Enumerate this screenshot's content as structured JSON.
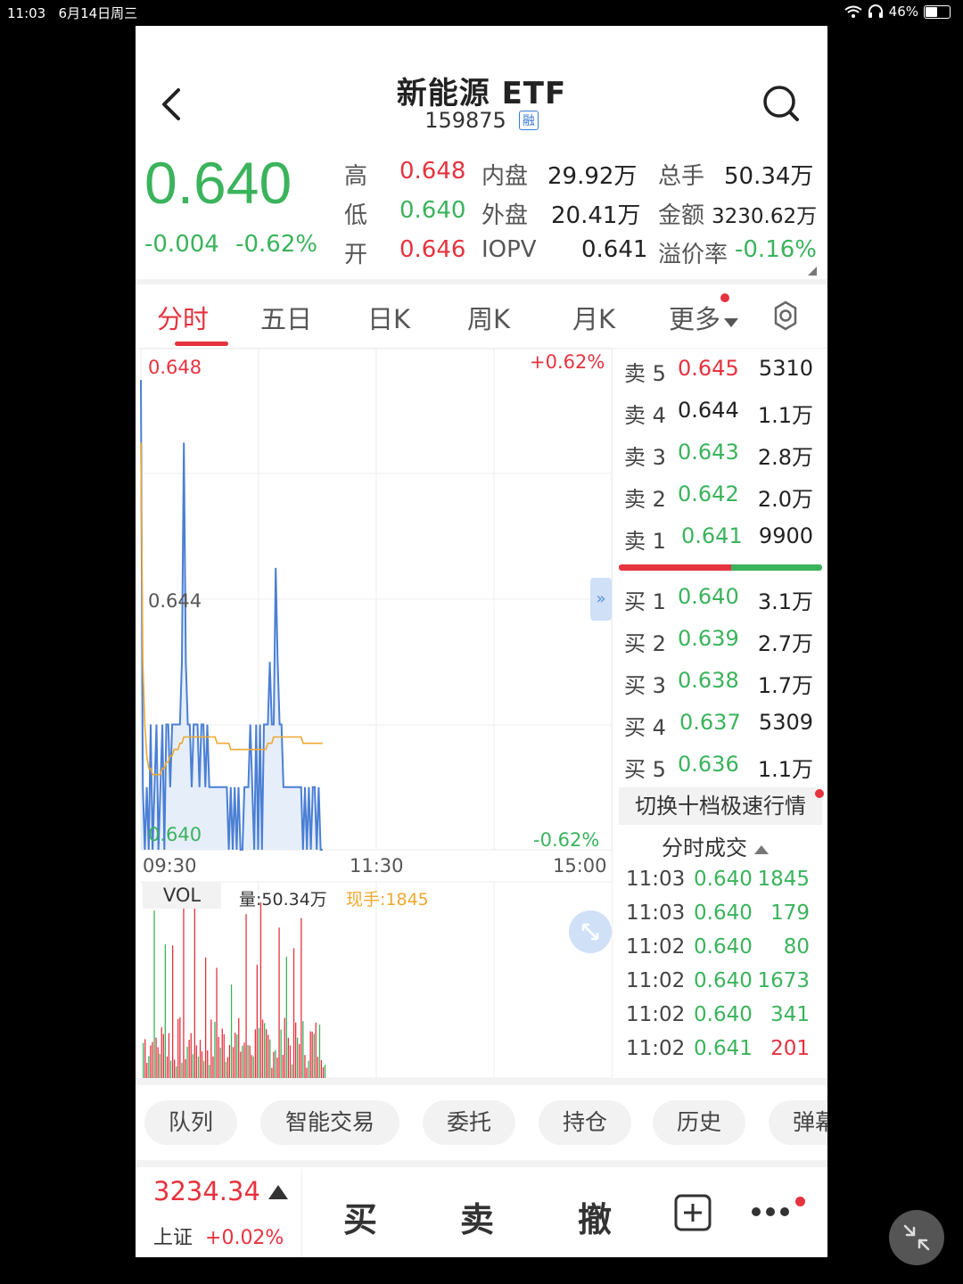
{
  "status_bar": {
    "time": "11:03",
    "date": "6月14日周三",
    "battery": "46%"
  },
  "header": {
    "title": "新能源 ETF",
    "code": "159875",
    "badge": "融"
  },
  "quote": {
    "price": "0.640",
    "change": "-0.004",
    "change_pct": "-0.62%",
    "stats": {
      "high_label": "高",
      "high": "0.648",
      "low_label": "低",
      "low": "0.640",
      "open_label": "开",
      "open": "0.646",
      "inner_label": "内盘",
      "inner": "29.92万",
      "outer_label": "外盘",
      "outer": "20.41万",
      "iopv_label": "IOPV",
      "iopv": "0.641",
      "total_label": "总手",
      "total": "50.34万",
      "amount_label": "金额",
      "amount": "3230.62万",
      "premium_label": "溢价率",
      "premium": "-0.16%"
    }
  },
  "tabs": [
    {
      "label": "分时",
      "active": true
    },
    {
      "label": "五日"
    },
    {
      "label": "日K"
    },
    {
      "label": "周K"
    },
    {
      "label": "月K"
    },
    {
      "label": "更多"
    }
  ],
  "chart": {
    "y_top": "0.648",
    "y_mid": "0.644",
    "y_bottom": "0.640",
    "pct_top": "+0.62%",
    "pct_bottom": "-0.62%",
    "x_start": "09:30",
    "x_mid": "11:30",
    "x_end": "15:00",
    "vol_tab": "VOL",
    "volume": "量:50.34万",
    "current_hand": "现手:1845"
  },
  "chart_data": {
    "type": "line",
    "series": [],
    "x": [
      0,
      1,
      2,
      3,
      4,
      5,
      6,
      7,
      8,
      9,
      10,
      11,
      12,
      13,
      14,
      15,
      16,
      17,
      18,
      19,
      20,
      21,
      22,
      23,
      24,
      25,
      26,
      27,
      28,
      29,
      30,
      31,
      32,
      33,
      34,
      35,
      36,
      37,
      38,
      39,
      40,
      41,
      42,
      43,
      44,
      45,
      46,
      47,
      48,
      49,
      50,
      51,
      52,
      53,
      54,
      55,
      56,
      57,
      58,
      59,
      60,
      61,
      62,
      63,
      64,
      65,
      66,
      67,
      68,
      69,
      70,
      71,
      72,
      73,
      74,
      75,
      76,
      77,
      78,
      79,
      80,
      81,
      82,
      83,
      84,
      85,
      86,
      87,
      88,
      89,
      90,
      91,
      92,
      93
    ],
    "price": [
      0.6475,
      0.641,
      0.64,
      0.641,
      0.64,
      0.642,
      0.64,
      0.641,
      0.642,
      0.64,
      0.641,
      0.642,
      0.64,
      0.642,
      0.642,
      0.641,
      0.642,
      0.642,
      0.642,
      0.642,
      0.642,
      0.643,
      0.6465,
      0.643,
      0.642,
      0.642,
      0.641,
      0.642,
      0.642,
      0.642,
      0.641,
      0.642,
      0.642,
      0.641,
      0.642,
      0.641,
      0.641,
      0.641,
      0.641,
      0.641,
      0.641,
      0.641,
      0.641,
      0.641,
      0.641,
      0.64,
      0.641,
      0.64,
      0.641,
      0.64,
      0.641,
      0.64,
      0.64,
      0.641,
      0.641,
      0.641,
      0.642,
      0.641,
      0.64,
      0.642,
      0.64,
      0.642,
      0.64,
      0.642,
      0.642,
      0.642,
      0.643,
      0.642,
      0.642,
      0.6445,
      0.643,
      0.642,
      0.642,
      0.641,
      0.641,
      0.641,
      0.641,
      0.641,
      0.641,
      0.641,
      0.641,
      0.641,
      0.641,
      0.64,
      0.641,
      0.64,
      0.641,
      0.64,
      0.641,
      0.641,
      0.64,
      0.641,
      0.64,
      0.64
    ],
    "avg": [
      0.6465,
      0.643,
      0.642,
      0.6415,
      0.6413,
      0.6413,
      0.6412,
      0.6412,
      0.6412,
      0.6412,
      0.6412,
      0.6413,
      0.6413,
      0.6414,
      0.6414,
      0.6415,
      0.6415,
      0.6416,
      0.6416,
      0.6416,
      0.6417,
      0.6417,
      0.6418,
      0.6418,
      0.6418,
      0.6418,
      0.6418,
      0.6418,
      0.6418,
      0.6418,
      0.6418,
      0.6418,
      0.6418,
      0.6418,
      0.6418,
      0.6418,
      0.6418,
      0.6418,
      0.6418,
      0.6417,
      0.6417,
      0.6417,
      0.6417,
      0.6417,
      0.6417,
      0.6417,
      0.6416,
      0.6416,
      0.6416,
      0.6416,
      0.6416,
      0.6416,
      0.6416,
      0.6416,
      0.6416,
      0.6416,
      0.6416,
      0.6416,
      0.6416,
      0.6416,
      0.6416,
      0.6416,
      0.6416,
      0.6416,
      0.6416,
      0.6417,
      0.6417,
      0.6417,
      0.6418,
      0.6418,
      0.6418,
      0.6418,
      0.6418,
      0.6418,
      0.6418,
      0.6418,
      0.6418,
      0.6418,
      0.6418,
      0.6418,
      0.6418,
      0.6418,
      0.6418,
      0.6417,
      0.6417,
      0.6417,
      0.6417,
      0.6417,
      0.6417,
      0.6417,
      0.6417,
      0.6417,
      0.6417,
      0.6417
    ],
    "ylim": [
      0.64,
      0.648
    ]
  },
  "order_book": {
    "asks": [
      {
        "label": "卖 5",
        "price": "0.645",
        "vol": "5310",
        "color": "red"
      },
      {
        "label": "卖 4",
        "price": "0.644",
        "vol": "1.1万",
        "color": "neutral"
      },
      {
        "label": "卖 3",
        "price": "0.643",
        "vol": "2.8万",
        "color": "green"
      },
      {
        "label": "卖 2",
        "price": "0.642",
        "vol": "2.0万",
        "color": "green"
      },
      {
        "label": "卖 1",
        "price": "0.641",
        "vol": "9900",
        "color": "green"
      }
    ],
    "bids": [
      {
        "label": "买 1",
        "price": "0.640",
        "vol": "3.1万"
      },
      {
        "label": "买 2",
        "price": "0.639",
        "vol": "2.7万"
      },
      {
        "label": "买 3",
        "price": "0.638",
        "vol": "1.7万"
      },
      {
        "label": "买 4",
        "price": "0.637",
        "vol": "5309"
      },
      {
        "label": "买 5",
        "price": "0.636",
        "vol": "1.1万"
      }
    ],
    "switch_label": "切换十档极速行情",
    "ticks_title": "分时成交",
    "ticks": [
      {
        "time": "11:03",
        "price": "0.640",
        "vol": "1845",
        "dir": "up"
      },
      {
        "time": "11:03",
        "price": "0.640",
        "vol": "179",
        "dir": "down"
      },
      {
        "time": "11:02",
        "price": "0.640",
        "vol": "80",
        "dir": "down"
      },
      {
        "time": "11:02",
        "price": "0.640",
        "vol": "1673",
        "dir": "down"
      },
      {
        "time": "11:02",
        "price": "0.640",
        "vol": "341",
        "dir": "down"
      },
      {
        "time": "11:02",
        "price": "0.641",
        "vol": "201",
        "dir": "up"
      }
    ]
  },
  "toolbar": [
    "队列",
    "智能交易",
    "委托",
    "持仓",
    "历史",
    "弹幕"
  ],
  "bottom_bar": {
    "index_value": "3234.34",
    "index_name": "上证",
    "index_change": "+0.02%",
    "buy": "买",
    "sell": "卖",
    "cancel": "撤"
  },
  "colors": {
    "up": "#e5333f",
    "down": "#3bb35c",
    "line": "#4a7fd4",
    "avg": "#f0a830"
  }
}
